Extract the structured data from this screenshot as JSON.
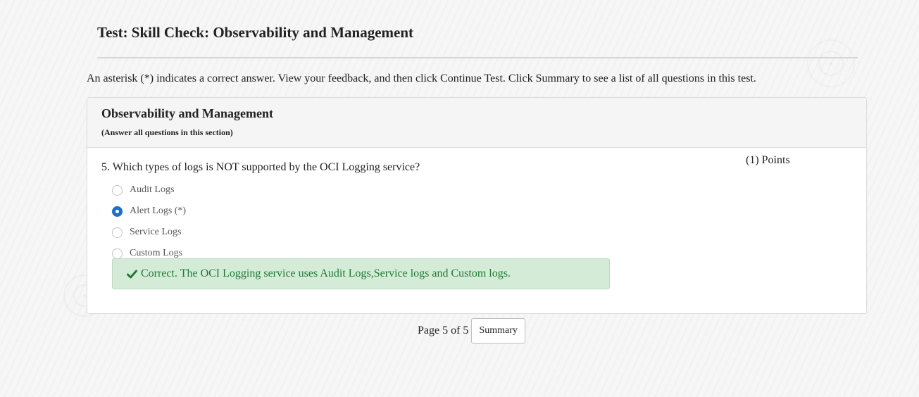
{
  "page": {
    "title": "Test: Skill Check: Observability and Management",
    "instructions": "An asterisk (*) indicates a correct answer. View your feedback, and then click Continue Test. Click Summary to see a list of all questions in this test."
  },
  "section": {
    "title": "Observability and Management",
    "subtitle": "(Answer all questions in this section)"
  },
  "question": {
    "text": "5. Which types of logs is NOT supported by the OCI Logging service?",
    "points": "(1) Points",
    "options": [
      {
        "label": "Audit Logs",
        "selected": false
      },
      {
        "label": "Alert Logs (*)",
        "selected": true
      },
      {
        "label": "Service Logs",
        "selected": false
      },
      {
        "label": "Custom Logs",
        "selected": false
      }
    ],
    "feedback": {
      "icon": "check-icon",
      "text": "Correct. The OCI Logging service uses Audit Logs,Service logs and Custom logs."
    }
  },
  "pager": {
    "page_info": "Page 5 of 5",
    "summary_label": "Summary"
  },
  "colors": {
    "selected_radio": "#1b6fd0",
    "feedback_bg": "#d4ecd7",
    "feedback_text": "#1e7a32"
  }
}
